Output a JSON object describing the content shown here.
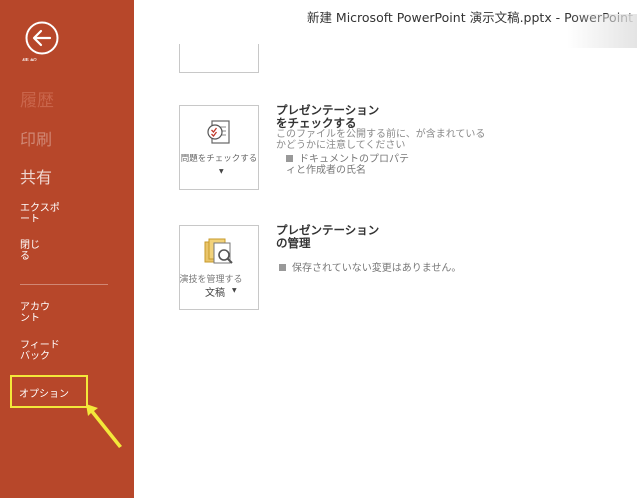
{
  "window": {
    "title": "新建 Microsoft PowerPoint 演示文稿.pptx  -  PowerPoint"
  },
  "sidebar": {
    "back_label": "情報",
    "items": [
      {
        "id": "history",
        "label": "履歴"
      },
      {
        "id": "print",
        "label": "印刷"
      },
      {
        "id": "share",
        "label": "共有"
      },
      {
        "id": "export",
        "label": "エクスポート"
      },
      {
        "id": "close",
        "label": "閉じる"
      },
      {
        "id": "account",
        "label": "アカウント"
      },
      {
        "id": "feedback",
        "label": "フィードバック"
      },
      {
        "id": "options",
        "label": "オプション"
      }
    ]
  },
  "inspect": {
    "tile_label": "問題をチェックする",
    "heading_line1": "プレゼンテーション",
    "heading_line2": "をチェックする",
    "desc": "このファイルを公開する前に、が含まれているかどうかに注意してください",
    "bullet1": "ドキュメントのプロパテ",
    "bullet2": "ィと作成者の氏名"
  },
  "manage": {
    "tile_label": "演技を管理する",
    "tile_caption": "文稿",
    "heading_line1": "プレゼンテーション",
    "heading_line2": "の管理",
    "bullet": "保存されていない変更はありません。"
  },
  "colors": {
    "sidebar_bg": "#b7472a",
    "highlight": "#f3e83a"
  }
}
